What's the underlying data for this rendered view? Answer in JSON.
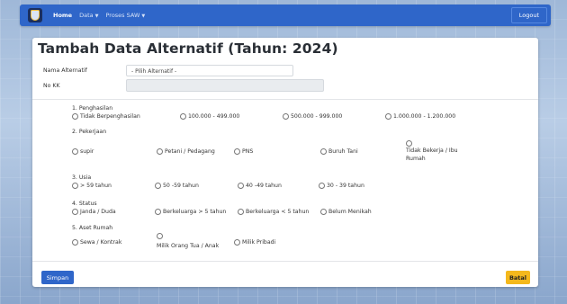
{
  "navbar": {
    "home": "Home",
    "data": "Data",
    "proses": "Proses SAW",
    "logout": "Logout",
    "caret": "▼"
  },
  "form": {
    "title": "Tambah Data Alternatif (Tahun: 2024)",
    "nama_label": "Nama Alternatif",
    "nama_value": "- Pilih Alternatif -",
    "nokk_label": "No KK"
  },
  "questions": [
    {
      "label": "1. Penghasilan",
      "options": [
        "Tidak Berpenghasilan",
        "100.000 - 499.000",
        "500.000 - 999.000",
        "1.000.000 - 1.200.000"
      ]
    },
    {
      "label": "2. Pekerjaan",
      "options": [
        "supir",
        "Petani / Pedagang",
        "PNS",
        "Buruh Tani",
        "Tidak Bekerja / Ibu",
        "Rumah"
      ]
    },
    {
      "label": "3. Usia",
      "options": [
        "> 59 tahun",
        "50 -59 tahun",
        "40 -49 tahun",
        "30 - 39 tahun"
      ]
    },
    {
      "label": "4. Status",
      "options": [
        "Janda / Duda",
        "Berkeluarga > 5 tahun",
        "Berkeluarga < 5 tahun",
        "Belum Menikah"
      ]
    },
    {
      "label": "5. Aset Rumah",
      "options": [
        "Sewa / Kontrak",
        "Milik Orang Tua / Anak",
        "Milik Pribadi"
      ]
    }
  ],
  "buttons": {
    "save": "Simpan",
    "cancel": "Batal"
  },
  "colors": {
    "primary": "#2f66c9",
    "warning": "#f4b81c"
  }
}
